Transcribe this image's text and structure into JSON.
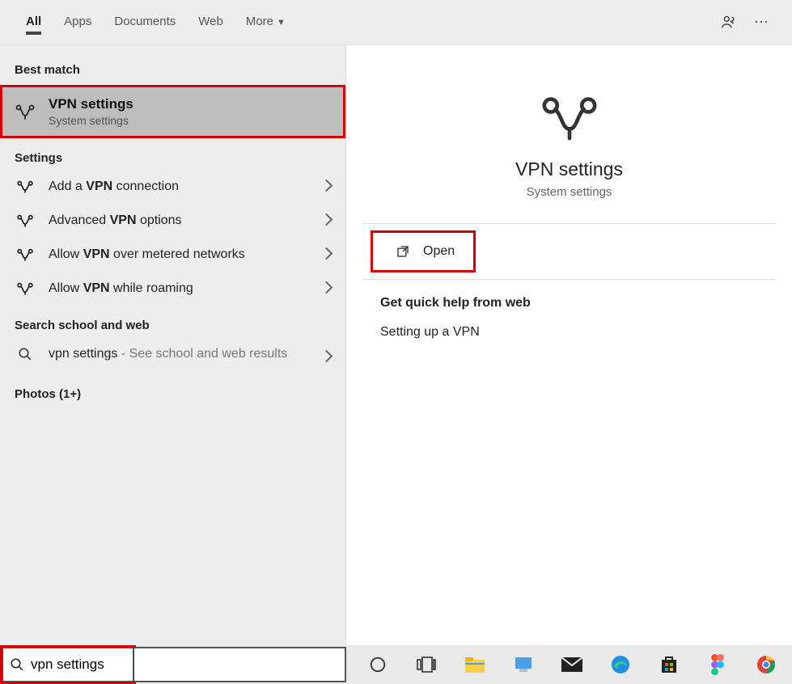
{
  "tabs": {
    "all": "All",
    "apps": "Apps",
    "documents": "Documents",
    "web": "Web",
    "more": "More"
  },
  "sections": {
    "best_match": "Best match",
    "settings": "Settings",
    "search_web": "Search school and web",
    "photos": "Photos (1+)"
  },
  "best": {
    "title": "VPN settings",
    "subtitle": "System settings"
  },
  "settings_items": {
    "add_pre": "Add a ",
    "add_bold": "VPN",
    "add_post": " connection",
    "adv_pre": "Advanced ",
    "adv_bold": "VPN",
    "adv_post": " options",
    "metered_pre": "Allow ",
    "metered_bold": "VPN",
    "metered_post": " over metered networks",
    "roam_pre": "Allow ",
    "roam_bold": "VPN",
    "roam_post": " while roaming"
  },
  "websearch": {
    "pre": "vpn settings",
    "post": " - See school and web results"
  },
  "detail": {
    "title": "VPN settings",
    "subtitle": "System settings",
    "open": "Open",
    "help_header": "Get quick help from web",
    "help_link": "Setting up a VPN"
  },
  "searchbox": {
    "value": "vpn settings"
  }
}
